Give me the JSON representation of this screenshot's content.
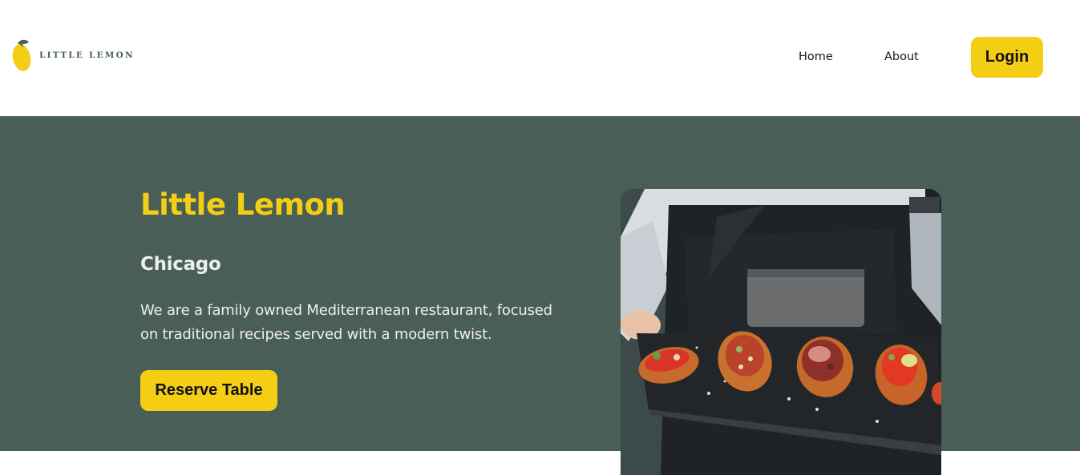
{
  "header": {
    "logo_text": "LITTLE LEMON",
    "nav": [
      {
        "label": "Home"
      },
      {
        "label": "About"
      }
    ],
    "login_label": "Login"
  },
  "hero": {
    "title": "Little Lemon",
    "subtitle": "Chicago",
    "description": "We are a family owned Mediterranean restaurant, focused on traditional recipes served with a modern twist.",
    "reserve_label": "Reserve Table",
    "image_subject": "waiter holding slate platter of bruschetta"
  },
  "colors": {
    "primary_green": "#495e57",
    "primary_yellow": "#f4ce14",
    "light_text": "#edefee",
    "background": "#ffffff"
  },
  "icons": {
    "logo": "lemon-logo-icon"
  }
}
